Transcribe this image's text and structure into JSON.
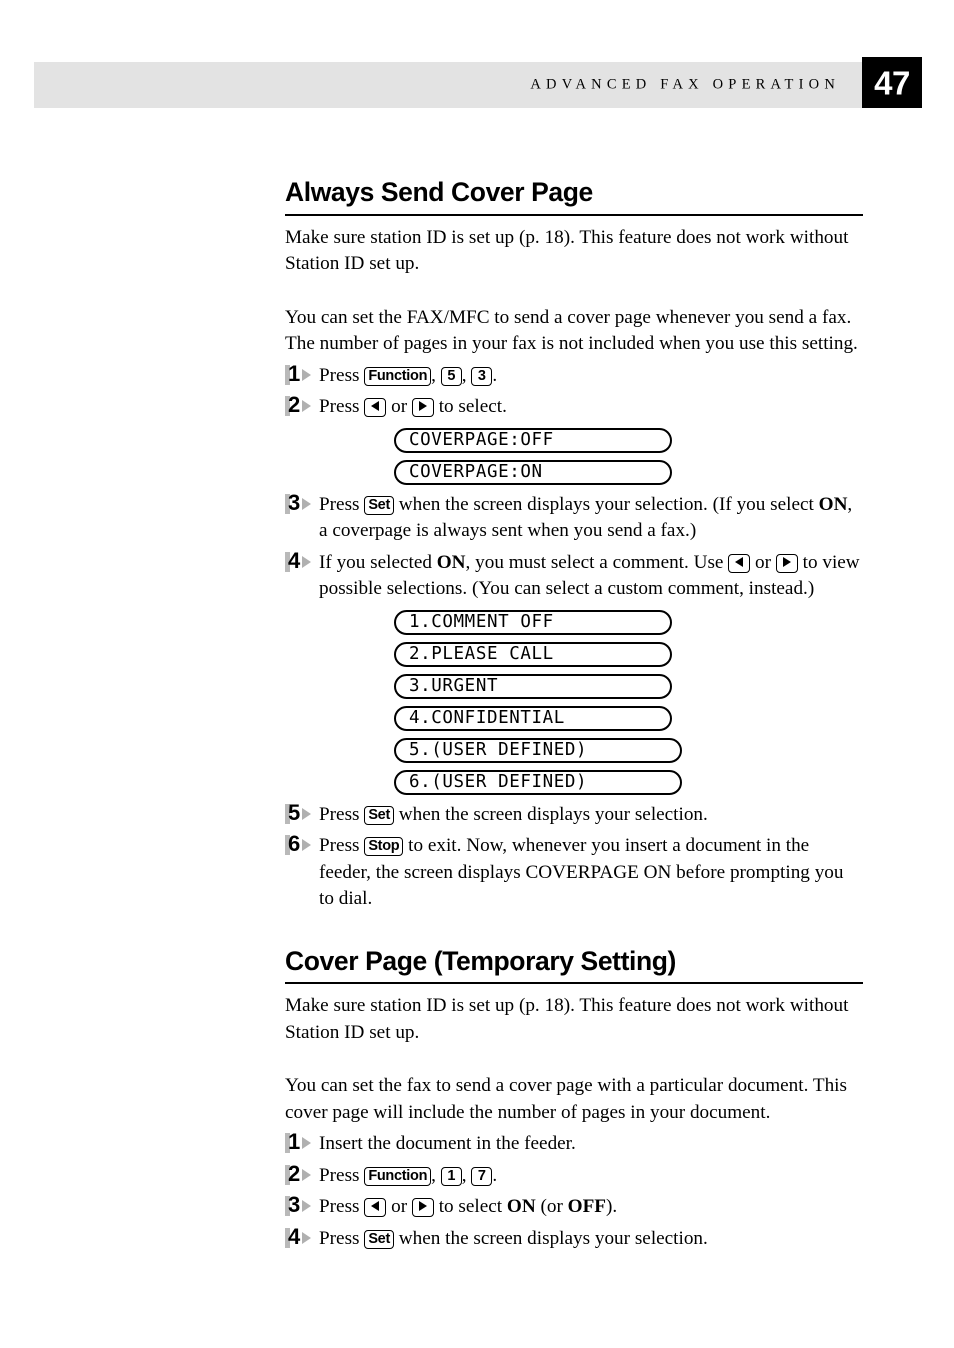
{
  "header": {
    "title": "ADVANCED FAX OPERATION",
    "page_number": "47",
    "band_color": "#e3e3e3",
    "page_box_color": "#000000"
  },
  "sections": [
    {
      "heading": "Always Send Cover Page",
      "intro": "Make sure station ID is set up (p. 18). This feature does not work without Station ID set up.",
      "body": "You can set the FAX/MFC to send a cover page whenever you send a fax. The number of pages in your fax is not included when you use this setting.",
      "steps": [
        {
          "number": "1",
          "parts": [
            {
              "t": "text",
              "v": "Press "
            },
            {
              "t": "key",
              "v": "Function"
            },
            {
              "t": "text",
              "v": ", "
            },
            {
              "t": "key-num",
              "v": "5"
            },
            {
              "t": "text",
              "v": ", "
            },
            {
              "t": "key-num",
              "v": "3"
            },
            {
              "t": "text",
              "v": "."
            }
          ]
        },
        {
          "number": "2",
          "parts": [
            {
              "t": "text",
              "v": "Press "
            },
            {
              "t": "key-arrow-left",
              "v": "left-arrow-key"
            },
            {
              "t": "text",
              "v": " or "
            },
            {
              "t": "key-arrow-right",
              "v": "right-arrow-key"
            },
            {
              "t": "text",
              "v": " to select."
            }
          ]
        },
        {
          "number": "3",
          "parts": [
            {
              "t": "text",
              "v": "Press "
            },
            {
              "t": "key",
              "v": "Set"
            },
            {
              "t": "text",
              "v": " when the screen displays your selection. (If you select "
            },
            {
              "t": "bold",
              "v": "ON"
            },
            {
              "t": "text",
              "v": ", a coverpage is always sent when you send a fax.)"
            }
          ]
        },
        {
          "number": "4",
          "parts": [
            {
              "t": "text",
              "v": "If you selected "
            },
            {
              "t": "bold",
              "v": "ON"
            },
            {
              "t": "text",
              "v": ", you must select a comment. Use "
            },
            {
              "t": "key-arrow-left",
              "v": "left-arrow-key"
            },
            {
              "t": "text",
              "v": " or "
            },
            {
              "t": "key-arrow-right",
              "v": "right-arrow-key"
            },
            {
              "t": "text",
              "v": " to view possible selections.  (You can select a custom comment, instead.)"
            }
          ]
        },
        {
          "number": "5",
          "parts": [
            {
              "t": "text",
              "v": "Press "
            },
            {
              "t": "key",
              "v": "Set"
            },
            {
              "t": "text",
              "v": " when the screen displays your selection."
            }
          ]
        },
        {
          "number": "6",
          "parts": [
            {
              "t": "text",
              "v": "Press "
            },
            {
              "t": "key",
              "v": "Stop"
            },
            {
              "t": "text",
              "v": " to exit. Now, whenever you insert a document in the feeder, the screen displays COVERPAGE ON before prompting you to dial."
            }
          ]
        }
      ]
    },
    {
      "heading": "Cover Page (Temporary Setting)",
      "intro": "Make sure station ID is set up (p. 18). This feature does not work without Station ID set up.",
      "body": "You can set the fax to send a cover page with a particular document. This cover page will include the number of pages in your document.",
      "steps": [
        {
          "number": "1",
          "parts": [
            {
              "t": "text",
              "v": "Insert the document in the feeder."
            }
          ]
        },
        {
          "number": "2",
          "parts": [
            {
              "t": "text",
              "v": "Press "
            },
            {
              "t": "key",
              "v": "Function"
            },
            {
              "t": "text",
              "v": ", "
            },
            {
              "t": "key-num",
              "v": "1"
            },
            {
              "t": "text",
              "v": ", "
            },
            {
              "t": "key-num",
              "v": "7"
            },
            {
              "t": "text",
              "v": "."
            }
          ]
        },
        {
          "number": "3",
          "parts": [
            {
              "t": "text",
              "v": "Press "
            },
            {
              "t": "key-arrow-left",
              "v": "left-arrow-key"
            },
            {
              "t": "text",
              "v": " or "
            },
            {
              "t": "key-arrow-right",
              "v": "right-arrow-key"
            },
            {
              "t": "text",
              "v": " to select "
            },
            {
              "t": "bold",
              "v": "ON"
            },
            {
              "t": "text",
              "v": " (or "
            },
            {
              "t": "bold",
              "v": "OFF"
            },
            {
              "t": "text",
              "v": ")."
            }
          ]
        },
        {
          "number": "4",
          "parts": [
            {
              "t": "text",
              "v": "Press "
            },
            {
              "t": "key",
              "v": "Set"
            },
            {
              "t": "text",
              "v": " when the screen displays your selection."
            }
          ]
        }
      ]
    }
  ],
  "lcd_groups": {
    "coverpage_toggle": [
      {
        "text": "COVERPAGE:OFF",
        "wide": false
      },
      {
        "text": "COVERPAGE:ON",
        "wide": false
      }
    ],
    "comments": [
      {
        "text": "1.COMMENT OFF",
        "wide": false
      },
      {
        "text": "2.PLEASE CALL",
        "wide": false
      },
      {
        "text": "3.URGENT",
        "wide": false
      },
      {
        "text": "4.CONFIDENTIAL",
        "wide": false
      },
      {
        "text": "5.(USER DEFINED)",
        "wide": true
      },
      {
        "text": "6.(USER DEFINED)",
        "wide": true
      }
    ]
  }
}
